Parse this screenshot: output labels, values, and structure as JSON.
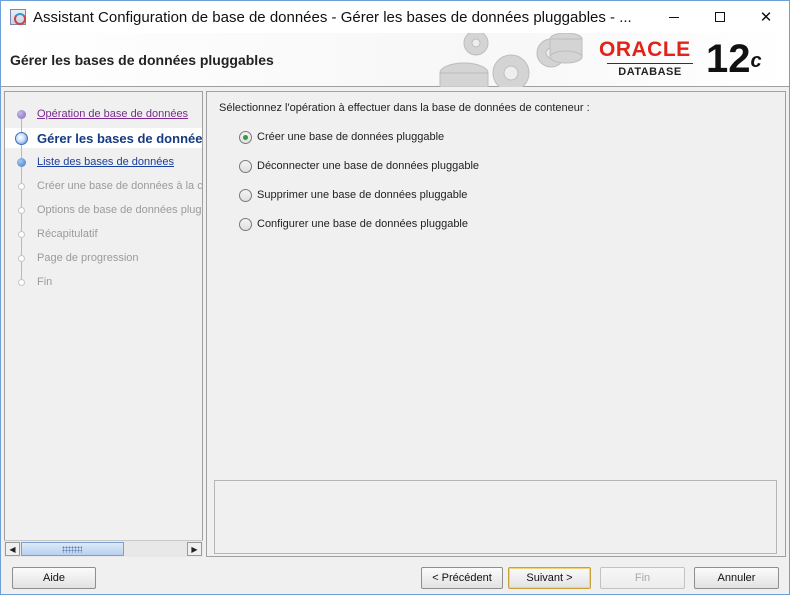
{
  "window": {
    "title": "Assistant Configuration de base de données - Gérer les bases de données pluggables - ...",
    "controls": {
      "minimize": "",
      "maximize": "",
      "close": "✕"
    }
  },
  "banner": {
    "page_title": "Gérer les bases de données pluggables",
    "logo_word": "ORACLE",
    "logo_sub": "DATABASE",
    "version": "12",
    "version_suffix": "c"
  },
  "nav": {
    "items": [
      {
        "label": "Opération de base de données",
        "state": "visited"
      },
      {
        "label": "Gérer les bases de données p",
        "state": "current"
      },
      {
        "label": "Liste des bases de données",
        "state": "link"
      },
      {
        "label": "Créer une base de données à la c",
        "state": "future"
      },
      {
        "label": "Options de base de données plugg",
        "state": "future"
      },
      {
        "label": "Récapitulatif",
        "state": "future"
      },
      {
        "label": "Page de progression",
        "state": "future"
      },
      {
        "label": "Fin",
        "state": "future"
      }
    ],
    "scroll_left": "◀",
    "scroll_right": "▶"
  },
  "main": {
    "instruction": "Sélectionnez l'opération à effectuer dans la base de données de conteneur :",
    "options": [
      {
        "label": "Créer une base de données pluggable",
        "checked": true
      },
      {
        "label": "Déconnecter une base de données pluggable",
        "checked": false
      },
      {
        "label": "Supprimer une base de données pluggable",
        "checked": false
      },
      {
        "label": "Configurer une base de données pluggable",
        "checked": false
      }
    ]
  },
  "buttons": {
    "help": "Aide",
    "previous": "< Précédent",
    "next": "Suivant >",
    "finish": "Fin",
    "cancel": "Annuler"
  },
  "colors": {
    "oracle_red": "#e2231a",
    "nav_current": "#163a80",
    "nav_link": "#1a3fa0",
    "nav_visited": "#7b2a8e",
    "radio_selected": "#2e9e3e"
  }
}
